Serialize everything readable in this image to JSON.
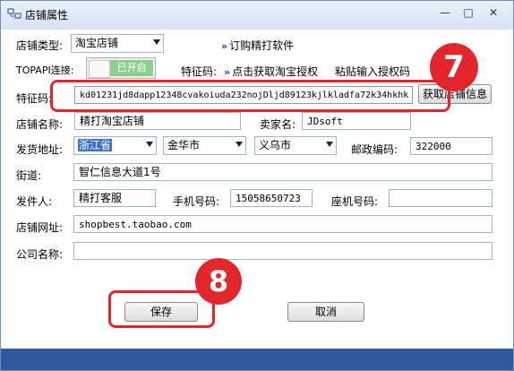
{
  "window": {
    "title": "店铺属性",
    "minimize": "—",
    "maximize": "□",
    "close": "✕"
  },
  "shop_type": {
    "label": "店铺类型:",
    "value": "淘宝店铺"
  },
  "subscribe_link": "订购精打软件",
  "topapi": {
    "label": "TOPAPI连接:",
    "toggle_text": "已开启"
  },
  "auth": {
    "label": "特征码:",
    "get_auth_link": "点击获取淘宝授权",
    "paste_button": "粘贴输入授权码"
  },
  "code": {
    "label": "特征码:",
    "value": "kd01231jd8dapp12348cvakoiuda232nojDljd89123kjlkladfa72k34hkhk",
    "fetch_button": "获取店铺信息"
  },
  "shop_name": {
    "label": "店铺名称:",
    "value": "精打淘宝店铺"
  },
  "seller_name": {
    "label": "卖家名:",
    "value": "JDsoft"
  },
  "ship_address": {
    "label": "发货地址:",
    "province": "浙江省",
    "city": "金华市",
    "district": "义乌市"
  },
  "postcode": {
    "label": "邮政编码:",
    "value": "322000"
  },
  "street": {
    "label": "街道:",
    "value": "智仁信息大道1号"
  },
  "sender": {
    "label": "发件人:",
    "value": "精打客服"
  },
  "mobile": {
    "label": "手机号码:",
    "value": "15058650723"
  },
  "landline": {
    "label": "座机号码:",
    "value": ""
  },
  "shop_url": {
    "label": "店铺网址:",
    "value": "shopbest.taobao.com"
  },
  "company": {
    "label": "公司名称:",
    "value": ""
  },
  "actions": {
    "save": "保存",
    "cancel": "取消"
  },
  "annotations": {
    "step7": "7",
    "step8": "8"
  },
  "colors": {
    "highlight": "#e3262c",
    "footer": "#2f5aa0",
    "toggle_on": "#8ccf8f"
  }
}
